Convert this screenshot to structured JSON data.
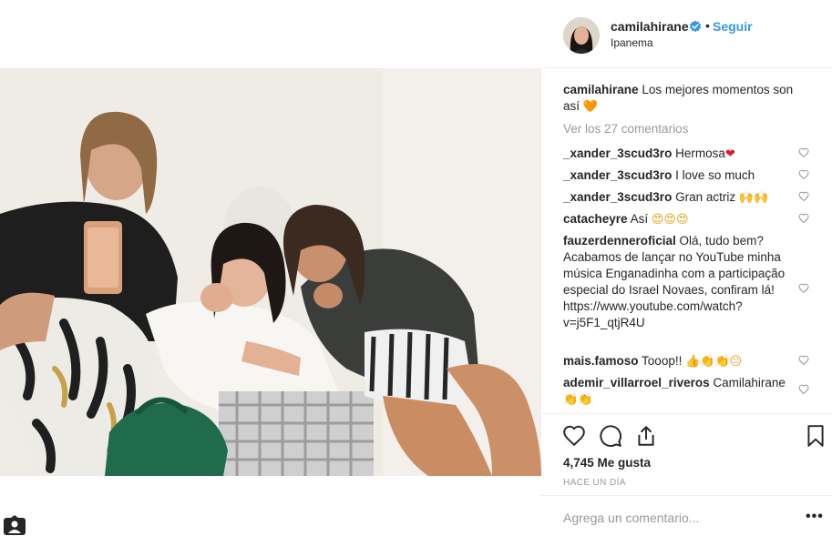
{
  "post": {
    "username": "camilahirane",
    "follow_label": "Seguir",
    "dot": "•",
    "location": "Ipanema",
    "caption_text": "Los mejores momentos son así",
    "caption_emoji": "🧡",
    "view_all_label": "Ver los 27 comentarios",
    "likes_label": "4,745 Me gusta",
    "time_label": "HACE UN DÍA",
    "comment_placeholder": "Agrega un comentario...",
    "more_label": "•••"
  },
  "comments": [
    {
      "user": "_xander_3scud3ro",
      "text": "Hermosa",
      "emoji": "❤"
    },
    {
      "user": "_xander_3scud3ro",
      "text": "I love so much",
      "emoji": ""
    },
    {
      "user": "_xander_3scud3ro",
      "text": "Gran actriz",
      "emoji": "🙌🙌"
    },
    {
      "user": "catacheyre",
      "text": "Así",
      "emoji": "😍😍😍"
    },
    {
      "user": "fauzerdenneroficial",
      "text": "Olá, tudo bem? Acabamos de lançar no YouTube minha música Enganadinha com a participação especial do Israel Novaes, confiram lá! https://www.youtube.com/watch?v=j5F1_qtjR4U",
      "emoji": ""
    },
    {
      "user": "mais.famoso",
      "text": "Tooop!!",
      "emoji": "👍👏👏😐"
    },
    {
      "user": "ademir_villarroel_riveros",
      "text": "Camilahirane",
      "emoji": "👏👏"
    }
  ],
  "colors": {
    "link": "#3897f0",
    "muted": "#999999",
    "text": "#262626",
    "divider": "#efefef"
  },
  "icons": [
    "verified-badge-icon",
    "heart-icon",
    "comment-icon",
    "share-icon",
    "bookmark-icon",
    "profile-tag-icon"
  ]
}
